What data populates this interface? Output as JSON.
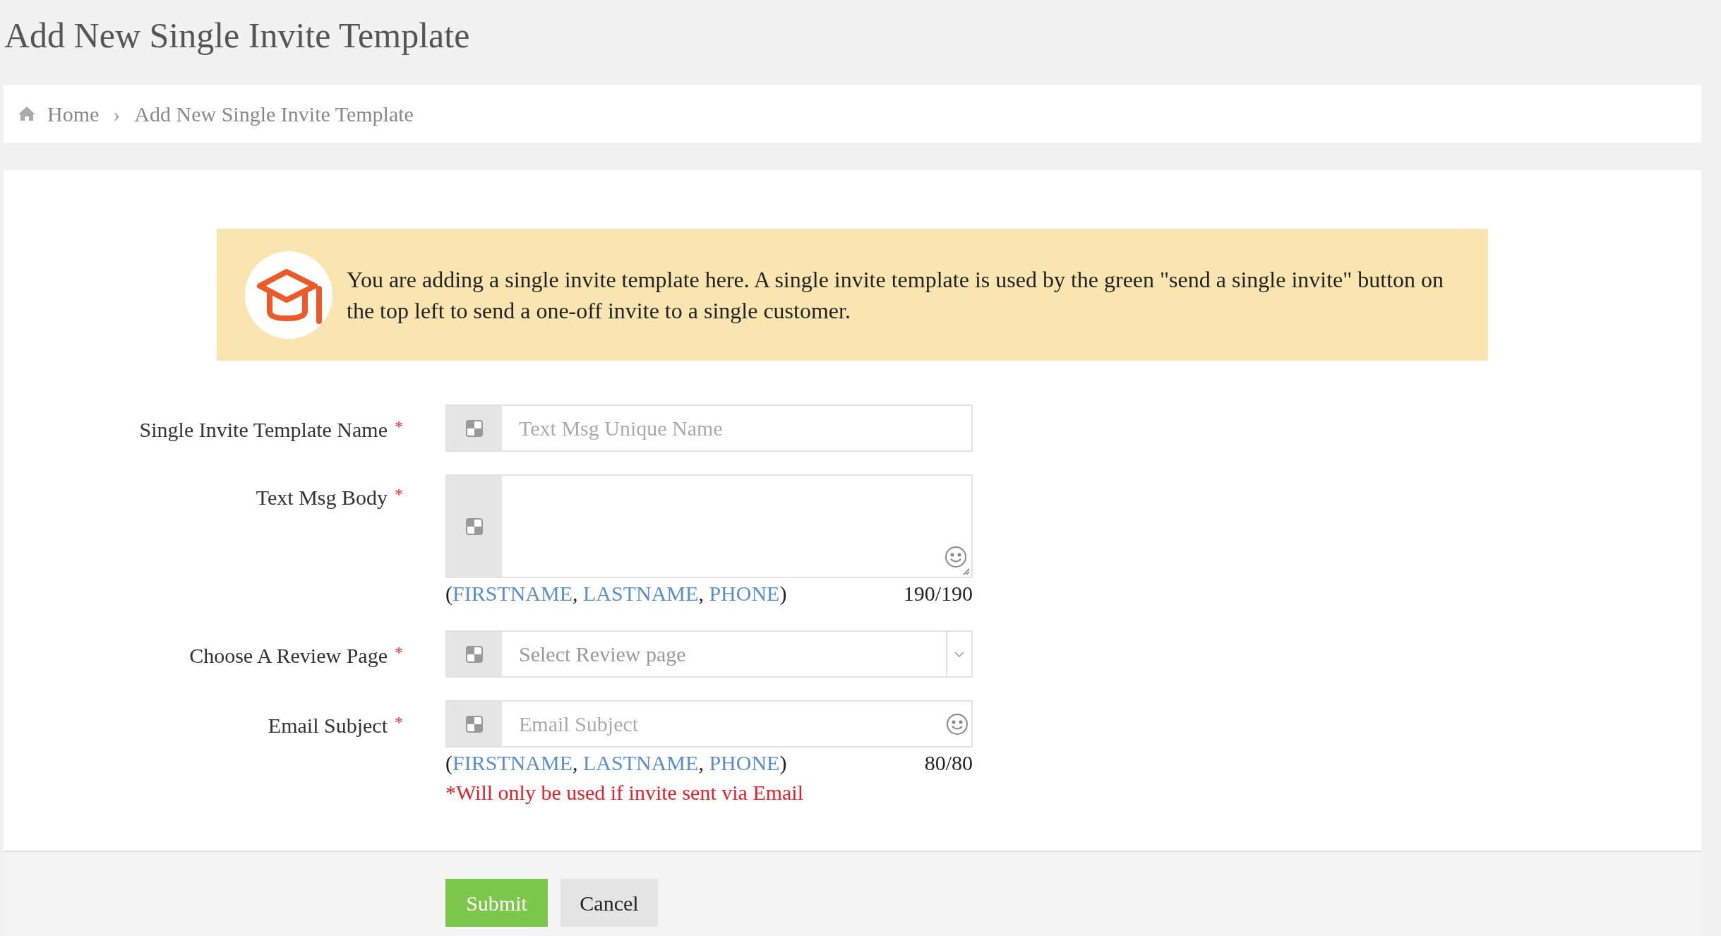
{
  "page_title": "Add New Single Invite Template",
  "breadcrumb": [
    {
      "label": "Home",
      "kind": "home"
    },
    {
      "label": "Add New Single Invite Template",
      "kind": "current"
    }
  ],
  "breadcrumb_separator": "›",
  "alert": {
    "text": "You are adding a single invite template here. A single invite template is used by the green \"send a single invite\" button on the top left to send a one-off invite to a single customer."
  },
  "fields": [
    {
      "kind": "input",
      "label": "Single Invite Template Name",
      "required_mark": "*",
      "placeholder": "Text Msg Unique Name",
      "emoji": false
    },
    {
      "kind": "textarea",
      "label": "Text Msg Body",
      "required_mark": "*",
      "emoji": true,
      "hint": [
        {
          "text": "(",
          "kind": "plain"
        },
        {
          "text": "FIRSTNAME",
          "kind": "variable"
        },
        {
          "text": ", ",
          "kind": "plain"
        },
        {
          "text": "LASTNAME",
          "kind": "variable"
        },
        {
          "text": ", ",
          "kind": "plain"
        },
        {
          "text": "PHONE",
          "kind": "variable"
        },
        {
          "text": ")",
          "kind": "plain"
        }
      ],
      "counter": "190/190"
    },
    {
      "kind": "select",
      "label": "Choose A Review Page",
      "required_mark": "*",
      "placeholder": "Select Review page"
    },
    {
      "kind": "input",
      "label": "Email Subject",
      "required_mark": "*",
      "placeholder": "Email Subject",
      "emoji": true,
      "hint": [
        {
          "text": "(",
          "kind": "plain"
        },
        {
          "text": "FIRSTNAME",
          "kind": "variable"
        },
        {
          "text": ", ",
          "kind": "plain"
        },
        {
          "text": "LASTNAME",
          "kind": "variable"
        },
        {
          "text": ", ",
          "kind": "plain"
        },
        {
          "text": "PHONE",
          "kind": "variable"
        },
        {
          "text": ")",
          "kind": "plain"
        }
      ],
      "counter": "80/80",
      "note": "*Will only be used if invite sent via Email"
    }
  ],
  "buttons": [
    {
      "label": "Submit",
      "kind": "primary"
    },
    {
      "label": "Cancel",
      "kind": "secondary"
    }
  ]
}
